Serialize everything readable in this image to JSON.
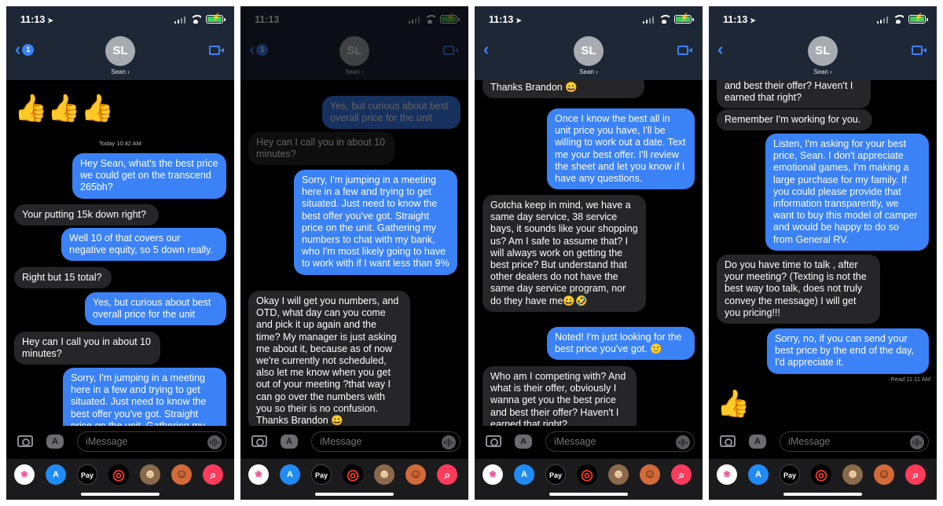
{
  "status": {
    "time": "11:13",
    "loc_glyph": "➤"
  },
  "header": {
    "avatar_initials": "SL",
    "contact_name": "Sean ›",
    "back_badge": "1",
    "back_glyph": "‹"
  },
  "input": {
    "placeholder": "iMessage"
  },
  "app_strip": [
    {
      "name": "photos-icon",
      "glyph": "❀",
      "bg": "#ffffff",
      "fg": "#e8508c"
    },
    {
      "name": "appstore-icon",
      "glyph": "A",
      "bg": "#1f8bf5",
      "fg": "#ffffff"
    },
    {
      "name": "applepay-icon",
      "glyph": "Pay",
      "bg": "#000000",
      "fg": "#ffffff"
    },
    {
      "name": "activity-icon",
      "glyph": "◎",
      "bg": "#000000",
      "fg": "#ff3b30"
    },
    {
      "name": "memoji-icon",
      "glyph": "☻",
      "bg": "#8a6a4a",
      "fg": "#f1d2a8"
    },
    {
      "name": "memoji2-icon",
      "glyph": "☺",
      "bg": "#d36a3a",
      "fg": "#2a1a0a"
    },
    {
      "name": "search-images-icon",
      "glyph": "⌕",
      "bg": "#ff3b5c",
      "fg": "#ffffff"
    }
  ],
  "screen1": {
    "emoji": "👍👍👍",
    "timestamp": "Today 10:42 AM",
    "messages": [
      {
        "dir": "out",
        "text": "Hey Sean, what's the best price we could get on the transcend 265bh?"
      },
      {
        "dir": "in",
        "text": "Your putting 15k down right?"
      },
      {
        "dir": "out",
        "text": "Well 10 of that covers our negative equity, so 5 down really."
      },
      {
        "dir": "in",
        "text": "Right but 15 total?"
      },
      {
        "dir": "out",
        "text": "Yes, but curious about best overall price for the unit"
      },
      {
        "dir": "in",
        "text": "Hey can I call you in about 10 minutes?"
      },
      {
        "dir": "out",
        "text": "Sorry, I'm jumping in a meeting here in a few and trying to get situated. Just need to know the best offer you've got. Straight price on the unit. Gathering my numbers to chat with my bank,"
      }
    ]
  },
  "screen2": {
    "messages": [
      {
        "dir": "out",
        "text": "Yes, but curious about best overall price for the unit"
      },
      {
        "dir": "in",
        "text": "Hey can I call you in about 10 minutes?"
      },
      {
        "dir": "out",
        "text": "Sorry, I'm jumping in a meeting here in a few and trying to get situated. Just need to know the best offer you've got. Straight price on the unit. Gathering my numbers to chat with my bank, who I'm most likely going to have to work with if I want less than 9%"
      },
      {
        "dir": "in",
        "text": "Okay I will get you numbers, and OTD, what day can you come and pick it up again and the time? My manager is just asking me about it, because as of now we're currently not scheduled, also let me know when you get out of your meeting ?that way I can go over the numbers with you so their is no confusion. Thanks Brandon 😀"
      }
    ]
  },
  "screen3": {
    "messages": [
      {
        "dir": "in",
        "text": "Thanks Brandon 😀"
      },
      {
        "dir": "out",
        "text": "Once I know the best all in unit price you have, I'll be willing to work out a date. Text me your best offer. I'll review the sheet and let you know if I have any questions."
      },
      {
        "dir": "in",
        "text": "Gotcha keep in mind, we have a same day service, 38 service bays, it sounds like your shopping us? Am I safe to assume that? I will always work on getting the best price? But understand that other dealers do not have the same day service program, nor do they have me😀🤣"
      },
      {
        "dir": "out",
        "text": "Noted! I'm just looking for the best price you've got. 🙂"
      },
      {
        "dir": "in",
        "text": "Who am I competing with? And what is their offer, obviously I wanna get you the best price and best their offer? Haven't I earned that right?"
      }
    ]
  },
  "screen4": {
    "messages": [
      {
        "dir": "in",
        "text": "and best their offer? Haven't I earned that right?"
      },
      {
        "dir": "in",
        "text": "Remember I'm working for you."
      },
      {
        "dir": "out",
        "text": "Listen, I'm asking for your best price, Sean. I don't appreciate emotional games, I'm making a large purchase for my family. If you could please provide that information transparently, we want to buy this model of camper and would be happy to do so from General RV."
      },
      {
        "dir": "in",
        "text": "Do you have time to talk , after your meeting? (Texting is not the best way too talk,  does not truly convey the message) I will get you pricing!!!"
      },
      {
        "dir": "out",
        "text": "Sorry, no, if you can send your best price by the end of the day, I'd appreciate it."
      }
    ],
    "read_receipt": "Read 11:11 AM",
    "emoji": "👍"
  }
}
